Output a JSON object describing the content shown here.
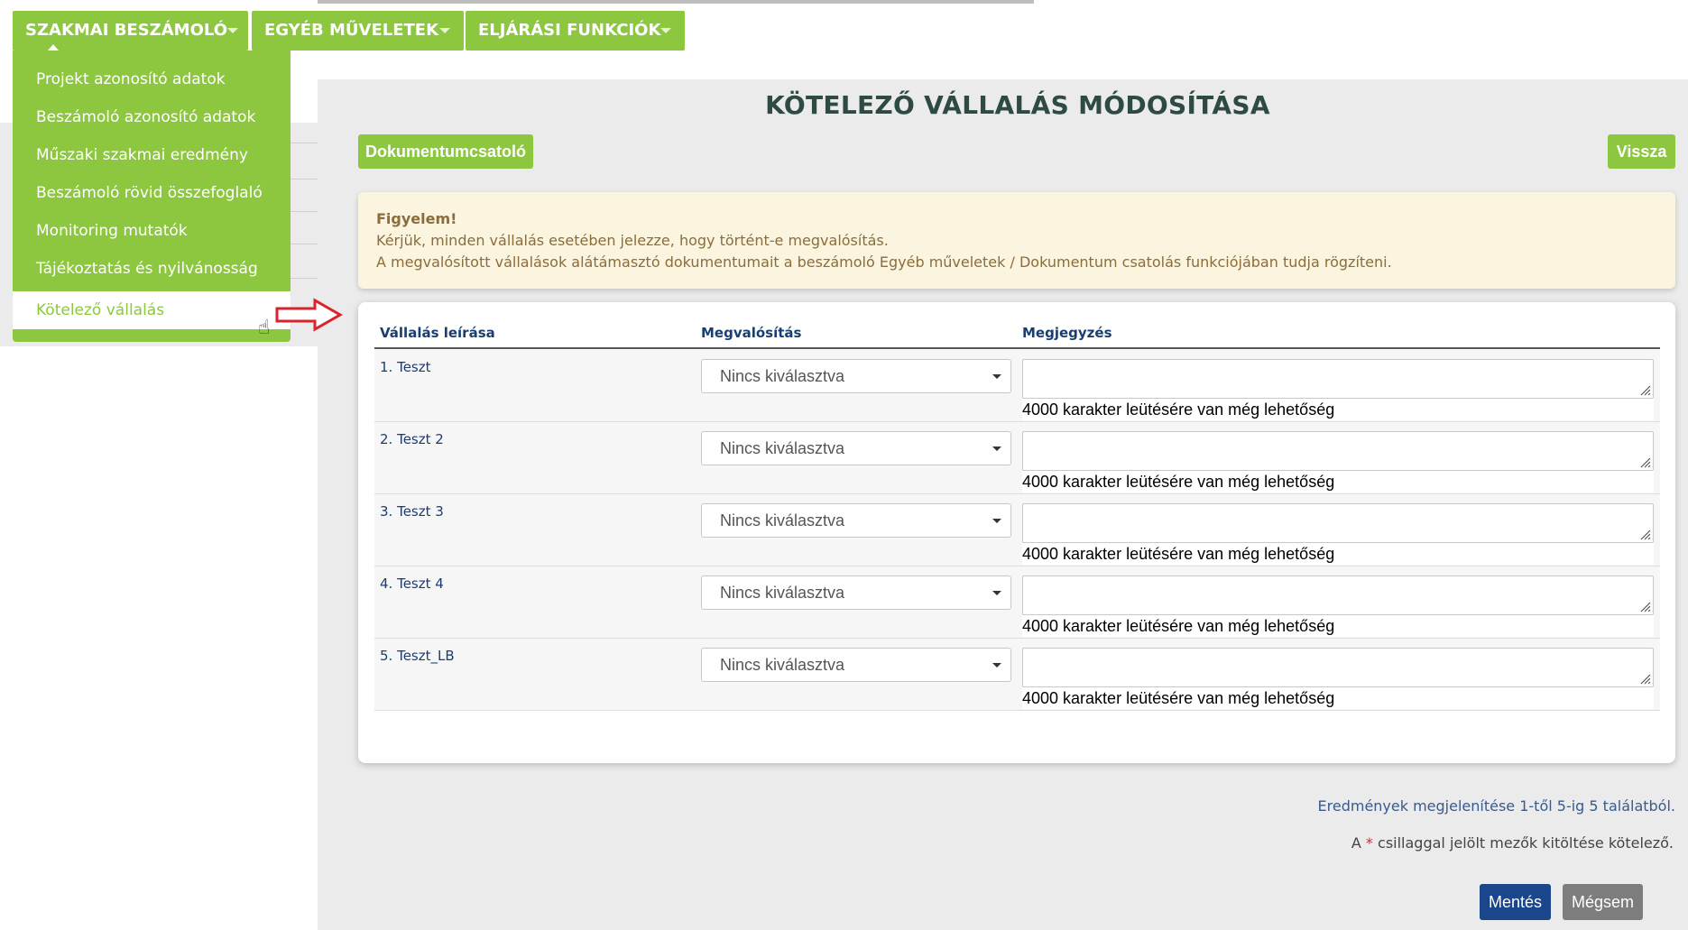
{
  "menubar": {
    "items": [
      {
        "label": "SZAKMAI BESZÁMOLÓ"
      },
      {
        "label": "EGYÉB MŰVELETEK"
      },
      {
        "label": "ELJÁRÁSI FUNKCIÓK"
      }
    ],
    "color": "#8dc63f"
  },
  "dropdown": {
    "items": [
      {
        "label": "Projekt azonosító adatok"
      },
      {
        "label": "Beszámoló azonosító adatok"
      },
      {
        "label": "Műszaki szakmai eredmény"
      },
      {
        "label": "Beszámoló rövid összefoglaló"
      },
      {
        "label": "Monitoring mutatók"
      },
      {
        "label": "Tájékoztatás és nyilvánosság"
      },
      {
        "label": "Kötelező vállalás"
      }
    ],
    "active_label": "Kötelező vállalás"
  },
  "page": {
    "title": "KÖTELEZŐ VÁLLALÁS MÓDOSÍTÁSA",
    "document_button": "Dokumentumcsatoló",
    "back_button": "Vissza"
  },
  "alert": {
    "title": "Figyelem!",
    "line1": "Kérjük, minden vállalás esetében jelezze, hogy történt-e megvalósítás.",
    "line2": "A megvalósított vállalások alátámasztó dokumentumait a beszámoló Egyéb műveletek / Dokumentum csatolás funkciójában tudja rögzíteni."
  },
  "table": {
    "headers": {
      "description": "Vállalás leírása",
      "implementation": "Megvalósítás",
      "note": "Megjegyzés"
    },
    "rows": [
      {
        "description": "1. Teszt",
        "implementation": "Nincs kiválasztva",
        "counter": "4000 karakter leütésére van még lehetőség"
      },
      {
        "description": "2. Teszt 2",
        "implementation": "Nincs kiválasztva",
        "counter": "4000 karakter leütésére van még lehetőség"
      },
      {
        "description": "3. Teszt 3",
        "implementation": "Nincs kiválasztva",
        "counter": "4000 karakter leütésére van még lehetőség"
      },
      {
        "description": "4. Teszt 4",
        "implementation": "Nincs kiválasztva",
        "counter": "4000 karakter leütésére van még lehetőség"
      },
      {
        "description": "5. Teszt_LB",
        "implementation": "Nincs kiválasztva",
        "counter": "4000 karakter leütésére van még lehetőség"
      }
    ]
  },
  "footer": {
    "result_info": "Eredmények megjelenítése 1-től 5-ig 5 találatból.",
    "required_prefix": "A",
    "required_star": "*",
    "required_suffix": "csillaggal jelölt mezők kitöltése kötelező.",
    "save_button": "Mentés",
    "cancel_button": "Mégsem"
  }
}
